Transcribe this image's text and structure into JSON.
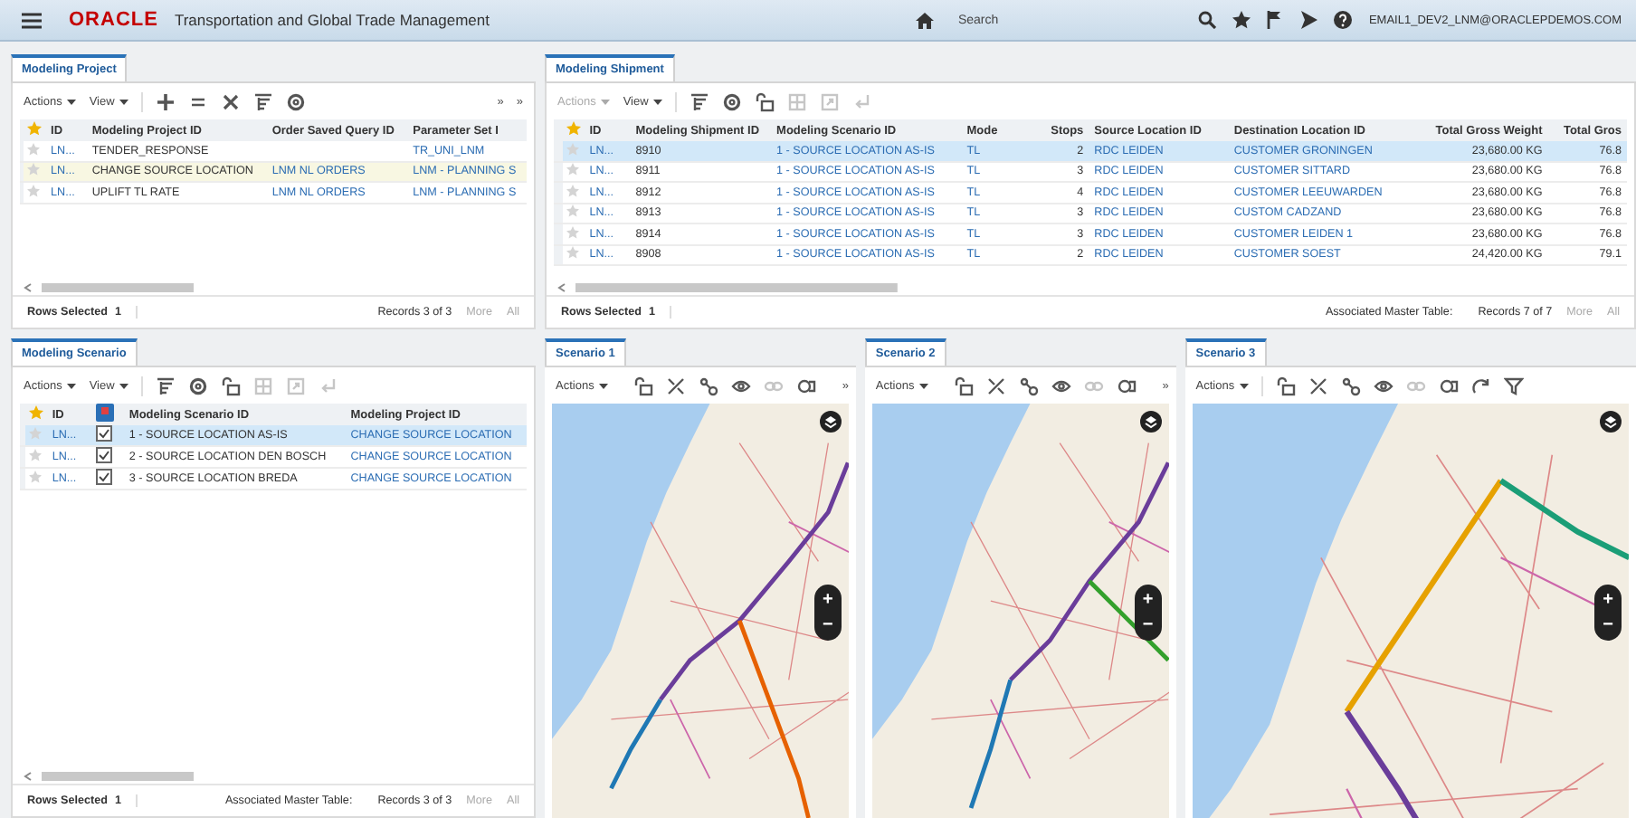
{
  "header": {
    "logo": "ORACLE",
    "title": "Transportation and Global Trade Management",
    "search": {
      "placeholder": "Search"
    },
    "user": "EMAIL1_DEV2_LNM@ORACLEPDEMOS.COM"
  },
  "project": {
    "tab": "Modeling Project",
    "actions": {
      "label": "Actions",
      "disabled": false
    },
    "view": "View",
    "icons": [
      {
        "kind": "plus",
        "disabled": false
      },
      {
        "kind": "equals",
        "disabled": false
      },
      {
        "kind": "delete",
        "disabled": false
      },
      {
        "kind": "columns",
        "disabled": false
      },
      {
        "kind": "settings",
        "disabled": false
      }
    ],
    "more": [
      "»",
      "»"
    ],
    "columns": [
      {
        "label": "ID",
        "kind": "link"
      },
      {
        "label": "Modeling Project ID",
        "kind": "text"
      },
      {
        "label": "Order Saved Query ID",
        "kind": "link"
      },
      {
        "label": "Parameter Set I",
        "kind": "link"
      }
    ],
    "rows": [
      {
        "selected": false,
        "cells": [
          "LN...",
          "TENDER_RESPONSE",
          "",
          "TR_UNI_LNM"
        ]
      },
      {
        "selected": true,
        "cells": [
          "LN...",
          "CHANGE SOURCE LOCATION",
          "LNM NL ORDERS",
          "LNM - PLANNING S"
        ]
      },
      {
        "selected": false,
        "cells": [
          "LN...",
          "UPLIFT TL RATE",
          "LNM NL ORDERS",
          "LNM - PLANNING S"
        ]
      }
    ],
    "footer": {
      "rows_selected": "Rows Selected",
      "count": "1",
      "records": "Records 3 of 3",
      "more": "More",
      "all": "All"
    }
  },
  "shipment": {
    "tab": "Modeling Shipment",
    "actions": {
      "label": "Actions",
      "disabled": true
    },
    "view": "View",
    "icons": [
      {
        "kind": "columns",
        "disabled": false
      },
      {
        "kind": "settings",
        "disabled": false
      },
      {
        "kind": "lock",
        "disabled": false
      },
      {
        "kind": "grid",
        "disabled": true
      },
      {
        "kind": "export",
        "disabled": true
      },
      {
        "kind": "return",
        "disabled": true
      }
    ],
    "columns": [
      {
        "label": "ID",
        "kind": "link"
      },
      {
        "label": "Modeling Shipment ID",
        "kind": "text"
      },
      {
        "label": "Modeling Scenario ID",
        "kind": "link"
      },
      {
        "label": "Mode",
        "kind": "link"
      },
      {
        "label": "Stops",
        "kind": "number"
      },
      {
        "label": "Source Location ID",
        "kind": "link"
      },
      {
        "label": "Destination Location ID",
        "kind": "link"
      },
      {
        "label": "Total Gross Weight",
        "kind": "number"
      },
      {
        "label": "Total Gros",
        "kind": "number"
      }
    ],
    "rows": [
      {
        "selected": true,
        "cells": [
          "LN...",
          "8910",
          "1 - SOURCE LOCATION AS-IS",
          "TL",
          "2",
          "RDC LEIDEN",
          "CUSTOMER GRONINGEN",
          "23,680.00 KG",
          "76.8"
        ]
      },
      {
        "selected": false,
        "cells": [
          "LN...",
          "8911",
          "1 - SOURCE LOCATION AS-IS",
          "TL",
          "3",
          "RDC LEIDEN",
          "CUSTOMER SITTARD",
          "23,680.00 KG",
          "76.8"
        ]
      },
      {
        "selected": false,
        "cells": [
          "LN...",
          "8912",
          "1 - SOURCE LOCATION AS-IS",
          "TL",
          "4",
          "RDC LEIDEN",
          "CUSTOMER LEEUWARDEN",
          "23,680.00 KG",
          "76.8"
        ]
      },
      {
        "selected": false,
        "cells": [
          "LN...",
          "8913",
          "1 - SOURCE LOCATION AS-IS",
          "TL",
          "3",
          "RDC LEIDEN",
          "CUSTOM CADZAND",
          "23,680.00 KG",
          "76.8"
        ]
      },
      {
        "selected": false,
        "cells": [
          "LN...",
          "8914",
          "1 - SOURCE LOCATION AS-IS",
          "TL",
          "3",
          "RDC LEIDEN",
          "CUSTOMER LEIDEN 1",
          "23,680.00 KG",
          "76.8"
        ]
      },
      {
        "selected": false,
        "cells": [
          "LN...",
          "8908",
          "1 - SOURCE LOCATION AS-IS",
          "TL",
          "2",
          "RDC LEIDEN",
          "CUSTOMER SOEST",
          "24,420.00 KG",
          "79.1"
        ]
      }
    ],
    "footer": {
      "rows_selected": "Rows Selected",
      "count": "1",
      "master": "Associated Master Table:",
      "records": "Records 7 of 7",
      "more": "More",
      "all": "All"
    }
  },
  "scenario": {
    "tab": "Modeling Scenario",
    "actions": {
      "label": "Actions",
      "disabled": false
    },
    "view": "View",
    "icons": [
      {
        "kind": "columns",
        "disabled": false
      },
      {
        "kind": "settings",
        "disabled": false
      },
      {
        "kind": "lock",
        "disabled": false
      },
      {
        "kind": "grid",
        "disabled": true
      },
      {
        "kind": "export",
        "disabled": true
      },
      {
        "kind": "return",
        "disabled": true
      }
    ],
    "columns": [
      {
        "label": "ID",
        "kind": "link"
      },
      {
        "kind": "check"
      },
      {
        "label": "Modeling Scenario ID",
        "kind": "text"
      },
      {
        "label": "Modeling Project ID",
        "kind": "link"
      }
    ],
    "rows": [
      {
        "selected": true,
        "checked": true,
        "cells": [
          "LN...",
          "",
          "1 - SOURCE LOCATION AS-IS",
          "CHANGE SOURCE LOCATION"
        ]
      },
      {
        "selected": false,
        "checked": true,
        "cells": [
          "LN...",
          "",
          "2 - SOURCE LOCATION DEN BOSCH",
          "CHANGE SOURCE LOCATION"
        ]
      },
      {
        "selected": false,
        "checked": true,
        "cells": [
          "LN...",
          "",
          "3 - SOURCE LOCATION BREDA",
          "CHANGE SOURCE LOCATION"
        ]
      }
    ],
    "footer": {
      "rows_selected": "Rows Selected",
      "count": "1",
      "master": "Associated Master Table:",
      "records": "Records 3 of 3",
      "more": "More",
      "all": "All"
    }
  },
  "maps": [
    {
      "tab": "Scenario 1",
      "actions": "Actions",
      "icons": [
        {
          "kind": "lock",
          "disabled": false
        },
        {
          "kind": "tools",
          "disabled": false
        },
        {
          "kind": "connect",
          "disabled": false
        },
        {
          "kind": "eye",
          "disabled": false
        },
        {
          "kind": "link",
          "disabled": true
        },
        {
          "kind": "stack",
          "disabled": false
        }
      ],
      "more": "»",
      "zoom_in": "+",
      "zoom_out": "−"
    },
    {
      "tab": "Scenario 2",
      "actions": "Actions",
      "icons": [
        {
          "kind": "lock",
          "disabled": false
        },
        {
          "kind": "tools",
          "disabled": false
        },
        {
          "kind": "connect",
          "disabled": false
        },
        {
          "kind": "eye",
          "disabled": false
        },
        {
          "kind": "link",
          "disabled": true
        },
        {
          "kind": "stack",
          "disabled": false
        }
      ],
      "more": "»",
      "zoom_in": "+",
      "zoom_out": "−"
    },
    {
      "tab": "Scenario 3",
      "actions": "Actions",
      "icons": [
        {
          "kind": "lock",
          "disabled": false
        },
        {
          "kind": "tools",
          "disabled": false
        },
        {
          "kind": "connect",
          "disabled": false
        },
        {
          "kind": "eye",
          "disabled": false
        },
        {
          "kind": "link",
          "disabled": true
        },
        {
          "kind": "stack",
          "disabled": false
        },
        {
          "kind": "rotate",
          "disabled": false
        },
        {
          "kind": "filter",
          "disabled": false
        }
      ],
      "zoom_in": "+",
      "zoom_out": "−"
    }
  ]
}
